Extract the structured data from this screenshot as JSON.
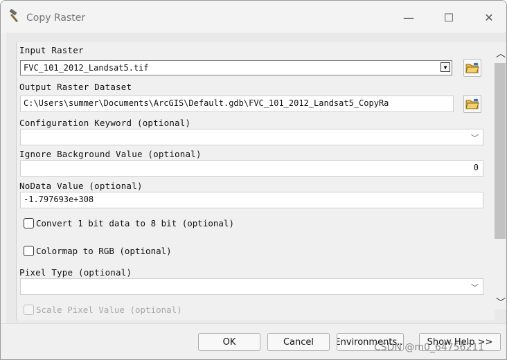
{
  "window": {
    "title": "Copy Raster",
    "minimize_glyph": "—",
    "maximize_glyph": "☐",
    "close_glyph": "✕"
  },
  "form": {
    "input_raster": {
      "label": "Input Raster",
      "value": "FVC_101_2012_Landsat5.tif"
    },
    "output_raster": {
      "label": "Output Raster Dataset",
      "value": "C:\\Users\\summer\\Documents\\ArcGIS\\Default.gdb\\FVC_101_2012_Landsat5_CopyRa"
    },
    "config_keyword": {
      "label": "Configuration Keyword (optional)",
      "value": ""
    },
    "ignore_background": {
      "label": "Ignore Background Value (optional)",
      "value": "0"
    },
    "nodata": {
      "label": "NoData Value (optional)",
      "value": "-1.797693e+308"
    },
    "convert_1bit": {
      "label": "Convert 1 bit data to 8 bit (optional)",
      "checked": false
    },
    "colormap_rgb": {
      "label": "Colormap to RGB (optional)",
      "checked": false
    },
    "pixel_type": {
      "label": "Pixel Type (optional)",
      "value": ""
    },
    "scale_pixel": {
      "label": "Scale Pixel Value (optional)",
      "checked": false,
      "disabled": true
    }
  },
  "icons": {
    "app": "hammer-icon",
    "browse": "folder-open-icon",
    "dropdown": "chevron-down-icon"
  },
  "buttons": {
    "ok": "OK",
    "cancel": "Cancel",
    "environments": "Environments...",
    "show_help": "Show Help >>"
  },
  "watermark": "CSDN @m0_64756211"
}
